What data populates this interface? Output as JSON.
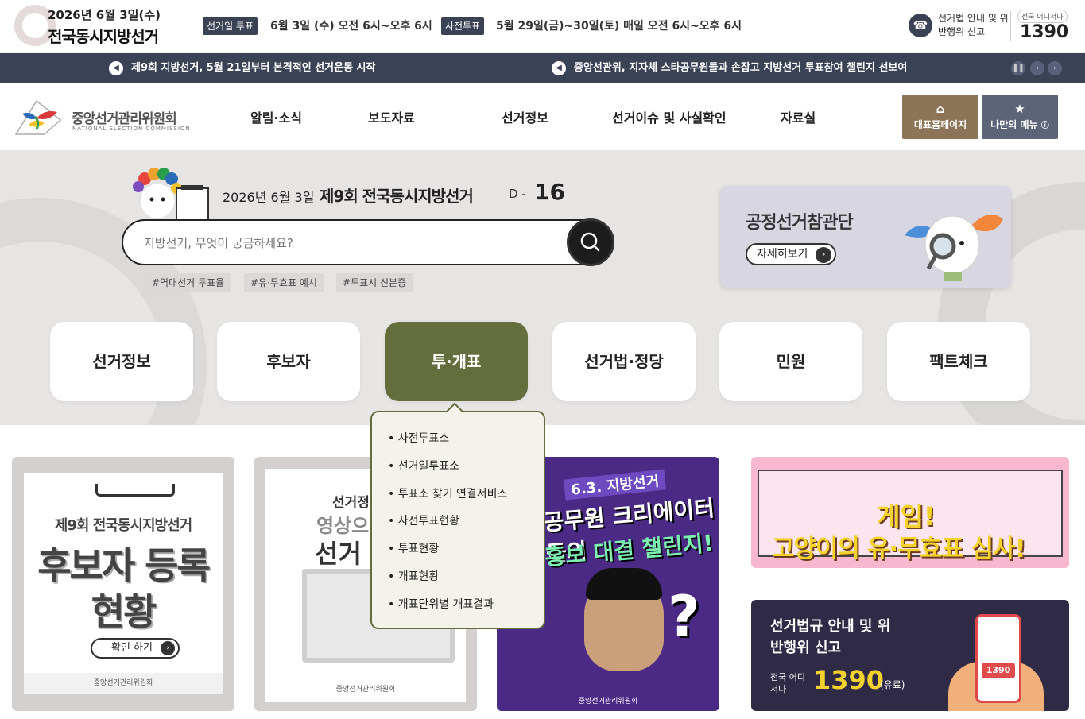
{
  "topbar": {
    "date": "2026년 6월 3일(수)",
    "title": "전국동시지방선거",
    "election_day_label": "선거일 투표",
    "election_day_time": "6월 3일 (수) 오전 6시~오후 6시",
    "early_vote_label": "사전투표",
    "early_vote_time": "5월 29일(금)~30일(토) 매일 오전 6시~오후 6시",
    "hotline_label": "선거법 안내 및 위반행위 신고",
    "anywhere_tag": "전국 어디서나",
    "hotline_number": "1390"
  },
  "newsbar": {
    "items": [
      "제9회 지방선거, 5월 21일부터 본격적인 선거운동 시작",
      "중앙선관위, 지자체 스타공무원들과 손잡고 지방선거 투표참여 챌린지 선보여"
    ],
    "controls": [
      "pause-icon",
      "prev-icon",
      "next-icon"
    ]
  },
  "header": {
    "org_name": "중앙선거관리위원회",
    "org_name_en": "NATIONAL ELECTION COMMISSION",
    "nav": [
      "알림·소식",
      "보도자료",
      "선거정보",
      "선거이슈 및 사실확인",
      "자료실"
    ],
    "home_button": "대표홈페이지",
    "mymenu_button": "나만의 메뉴"
  },
  "hero": {
    "dday_date": "2026년 6월 3일",
    "dday_title": "제9회 전국동시지방선거",
    "dday_prefix": "D -",
    "dday_value": "16",
    "search_placeholder": "지방선거, 무엇이 궁금하세요?",
    "tags": [
      "#역대선거 투표율",
      "#유·무효표 예시",
      "#투표시 신분증"
    ],
    "promo_title": "공정선거참관단",
    "promo_button": "자세히보기"
  },
  "categories": [
    "선거정보",
    "후보자",
    "투·개표",
    "선거법·정당",
    "민원",
    "팩트체크"
  ],
  "active_category": "투·개표",
  "dropdown": [
    "사전투표소",
    "선거일투표소",
    "투표소 찾기 연결서비스",
    "사전투표현황",
    "투표현황",
    "개표현황",
    "개표단위별 개표결과"
  ],
  "cards": {
    "c1": {
      "title": "제9회 전국동시지방선거",
      "main": "후보자 등록현황",
      "button": "확인 하기",
      "footer": "중앙선거관리위원회"
    },
    "c2": {
      "t1": "선거정보",
      "t2": "영상으로",
      "t3": "선거",
      "footer": "중앙선거관리위원회"
    },
    "c3": {
      "s1": "6.3. 지방선거",
      "s2": "공무원 크리에이터들의",
      "s3": "홍보 대결 챌린지!",
      "footer": "중앙선거관리위원회"
    },
    "c4": {
      "g1": "게임!",
      "g2": "고양이의 유·무효표 심사!"
    },
    "c5": {
      "title": "선거법규 안내 및 위반행위 신고",
      "anywhere": "전국 어디서나",
      "number": "1390",
      "fee": "(유료)",
      "phone_label": "1390"
    }
  },
  "colors": {
    "navy": "#3a4256",
    "olive": "#646e3c",
    "hero_bg": "#e7e4e4"
  }
}
